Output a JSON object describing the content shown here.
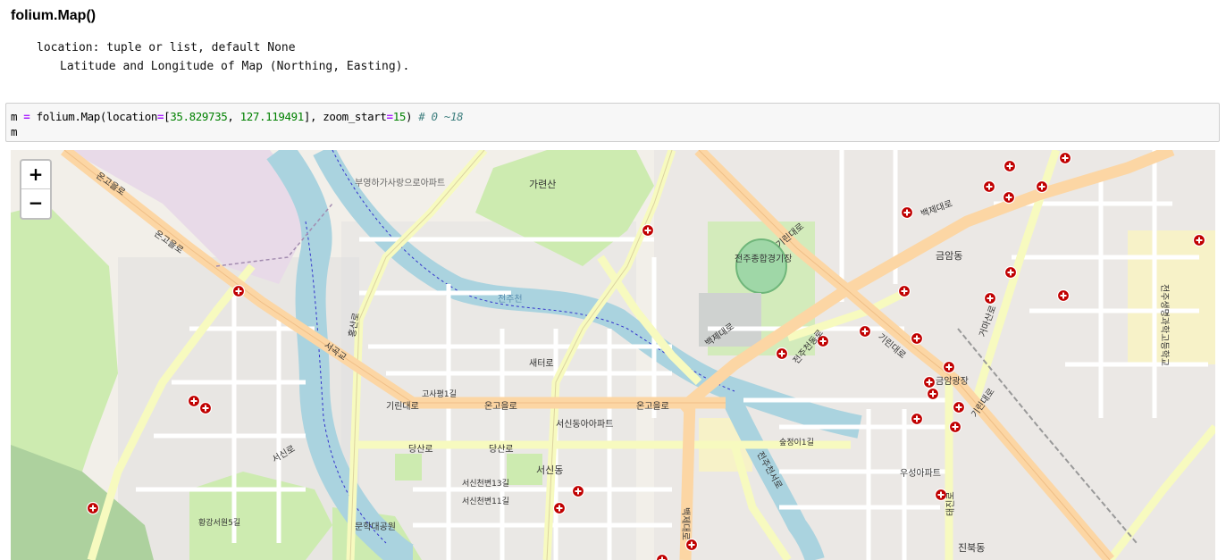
{
  "heading": "folium.Map()",
  "doc": {
    "line1": "location: tuple or list, default None",
    "line2": "Latitude and Longitude of Map (Northing, Easting)."
  },
  "code": {
    "var": "m",
    "assign": "=",
    "call_prefix": "folium.Map(location",
    "bracket_open": "[",
    "lat": "35.829735",
    "sep": ", ",
    "lon": "127.119491",
    "zoom_part": "], zoom_start",
    "zoom_val": "15",
    "close": ")",
    "comment": "# 0 ~18",
    "line2": "m"
  },
  "zoom": {
    "in": "+",
    "out": "−"
  },
  "map_labels": {
    "l1": "온고을로",
    "l2": "온고을로",
    "l3": "온고을로",
    "l4": "온고을로",
    "l5": "가련산",
    "l6": "전주천",
    "l7": "기린대로",
    "l8": "기린대로",
    "l9": "백제대로",
    "l10": "백제대로",
    "l11": "전주종합경기장",
    "l12": "서신동아아파트",
    "l13": "금암동",
    "l14": "금암광장",
    "l15": "전주생명과학고등학교",
    "l16": "서신동",
    "l17": "우성아파트",
    "l18": "문학대공원",
    "l19": "진북동",
    "l20": "서곡교",
    "l21": "새터로",
    "l22": "당산로",
    "l23": "당산로",
    "l24": "서신로",
    "l25": "거마산로",
    "l26": "기린대로",
    "l27": "부영하가사랑으로아파트",
    "l28": "태진로",
    "l29": "전주천동로",
    "l30": "기린대로",
    "l31": "홍산로",
    "l32": "전주천서로",
    "l33": "서신천변13길",
    "l34": "서신천변11길",
    "l35": "고사평1길",
    "l36": "황강서원5길",
    "l37": "숲정이1길",
    "l38": "백제대로"
  },
  "colors": {
    "marker": "#c00000",
    "major_road": "#fcd6a4",
    "secondary_road": "#f7fabf",
    "water": "#aad3df",
    "park": "#cdebb0"
  }
}
